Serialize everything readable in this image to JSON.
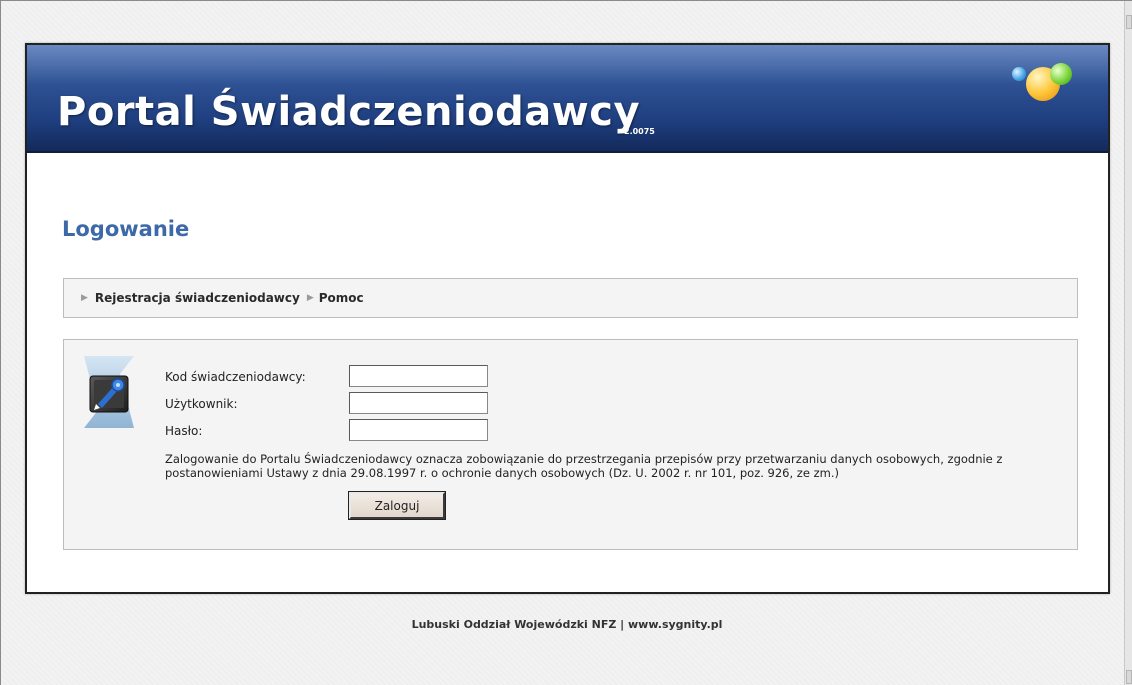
{
  "header": {
    "title": "Portal Świadczeniodawcy",
    "version": "2.0075"
  },
  "page": {
    "heading": "Logowanie"
  },
  "nav": {
    "items": [
      {
        "label": "Rejestracja świadczeniodawcy"
      },
      {
        "label": "Pomoc"
      }
    ]
  },
  "login": {
    "fields": [
      {
        "label": "Kod świadczeniodawcy:",
        "value": ""
      },
      {
        "label": "Użytkownik:",
        "value": ""
      },
      {
        "label": "Hasło:",
        "value": ""
      }
    ],
    "notice": "Zalogowanie do Portalu Świadczeniodawcy oznacza zobowiązanie do przestrzegania przepisów przy przetwarzaniu danych osobowych, zgodnie z postanowieniami Ustawy z dnia 29.08.1997 r. o ochronie danych osobowych (Dz. U. 2002 r. nr 101, poz. 926, ze zm.)",
    "button_label": "Zaloguj"
  },
  "footer": {
    "text": "Lubuski Oddział Wojewódzki NFZ | www.sygnity.pl"
  },
  "colors": {
    "banner": "#1f3f80",
    "heading": "#3d69a8"
  },
  "icons": {
    "logo": "colored-balls-logo",
    "login": "key-card-icon",
    "nav_bullet": "triangle-right-icon"
  }
}
